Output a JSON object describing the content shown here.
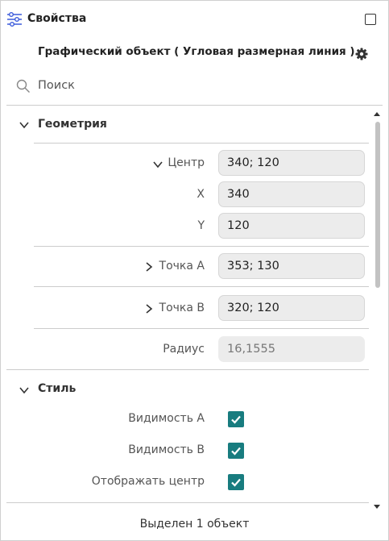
{
  "panel": {
    "title": "Свойства",
    "subtitle": "Графический объект ( Угловая размерная линия )",
    "search_placeholder": "Поиск"
  },
  "geometry": {
    "title": "Геометрия",
    "center_label": "Центр",
    "center_value": "340; 120",
    "x_label": "X",
    "x_value": "340",
    "y_label": "Y",
    "y_value": "120",
    "point_a_label": "Точка А",
    "point_a_value": "353; 130",
    "point_b_label": "Точка В",
    "point_b_value": "320; 120",
    "radius_label": "Радиус",
    "radius_value": "16,1555"
  },
  "style": {
    "title": "Стиль",
    "visibility_a_label": "Видимость А",
    "visibility_a_checked": true,
    "visibility_b_label": "Видимость В",
    "visibility_b_checked": true,
    "show_center_label": "Отображать центр",
    "show_center_checked": true
  },
  "status": "Выделен 1 объект",
  "colors": {
    "accent": "#187c7f",
    "field_bg": "#ececec",
    "divider": "#cccccc"
  }
}
